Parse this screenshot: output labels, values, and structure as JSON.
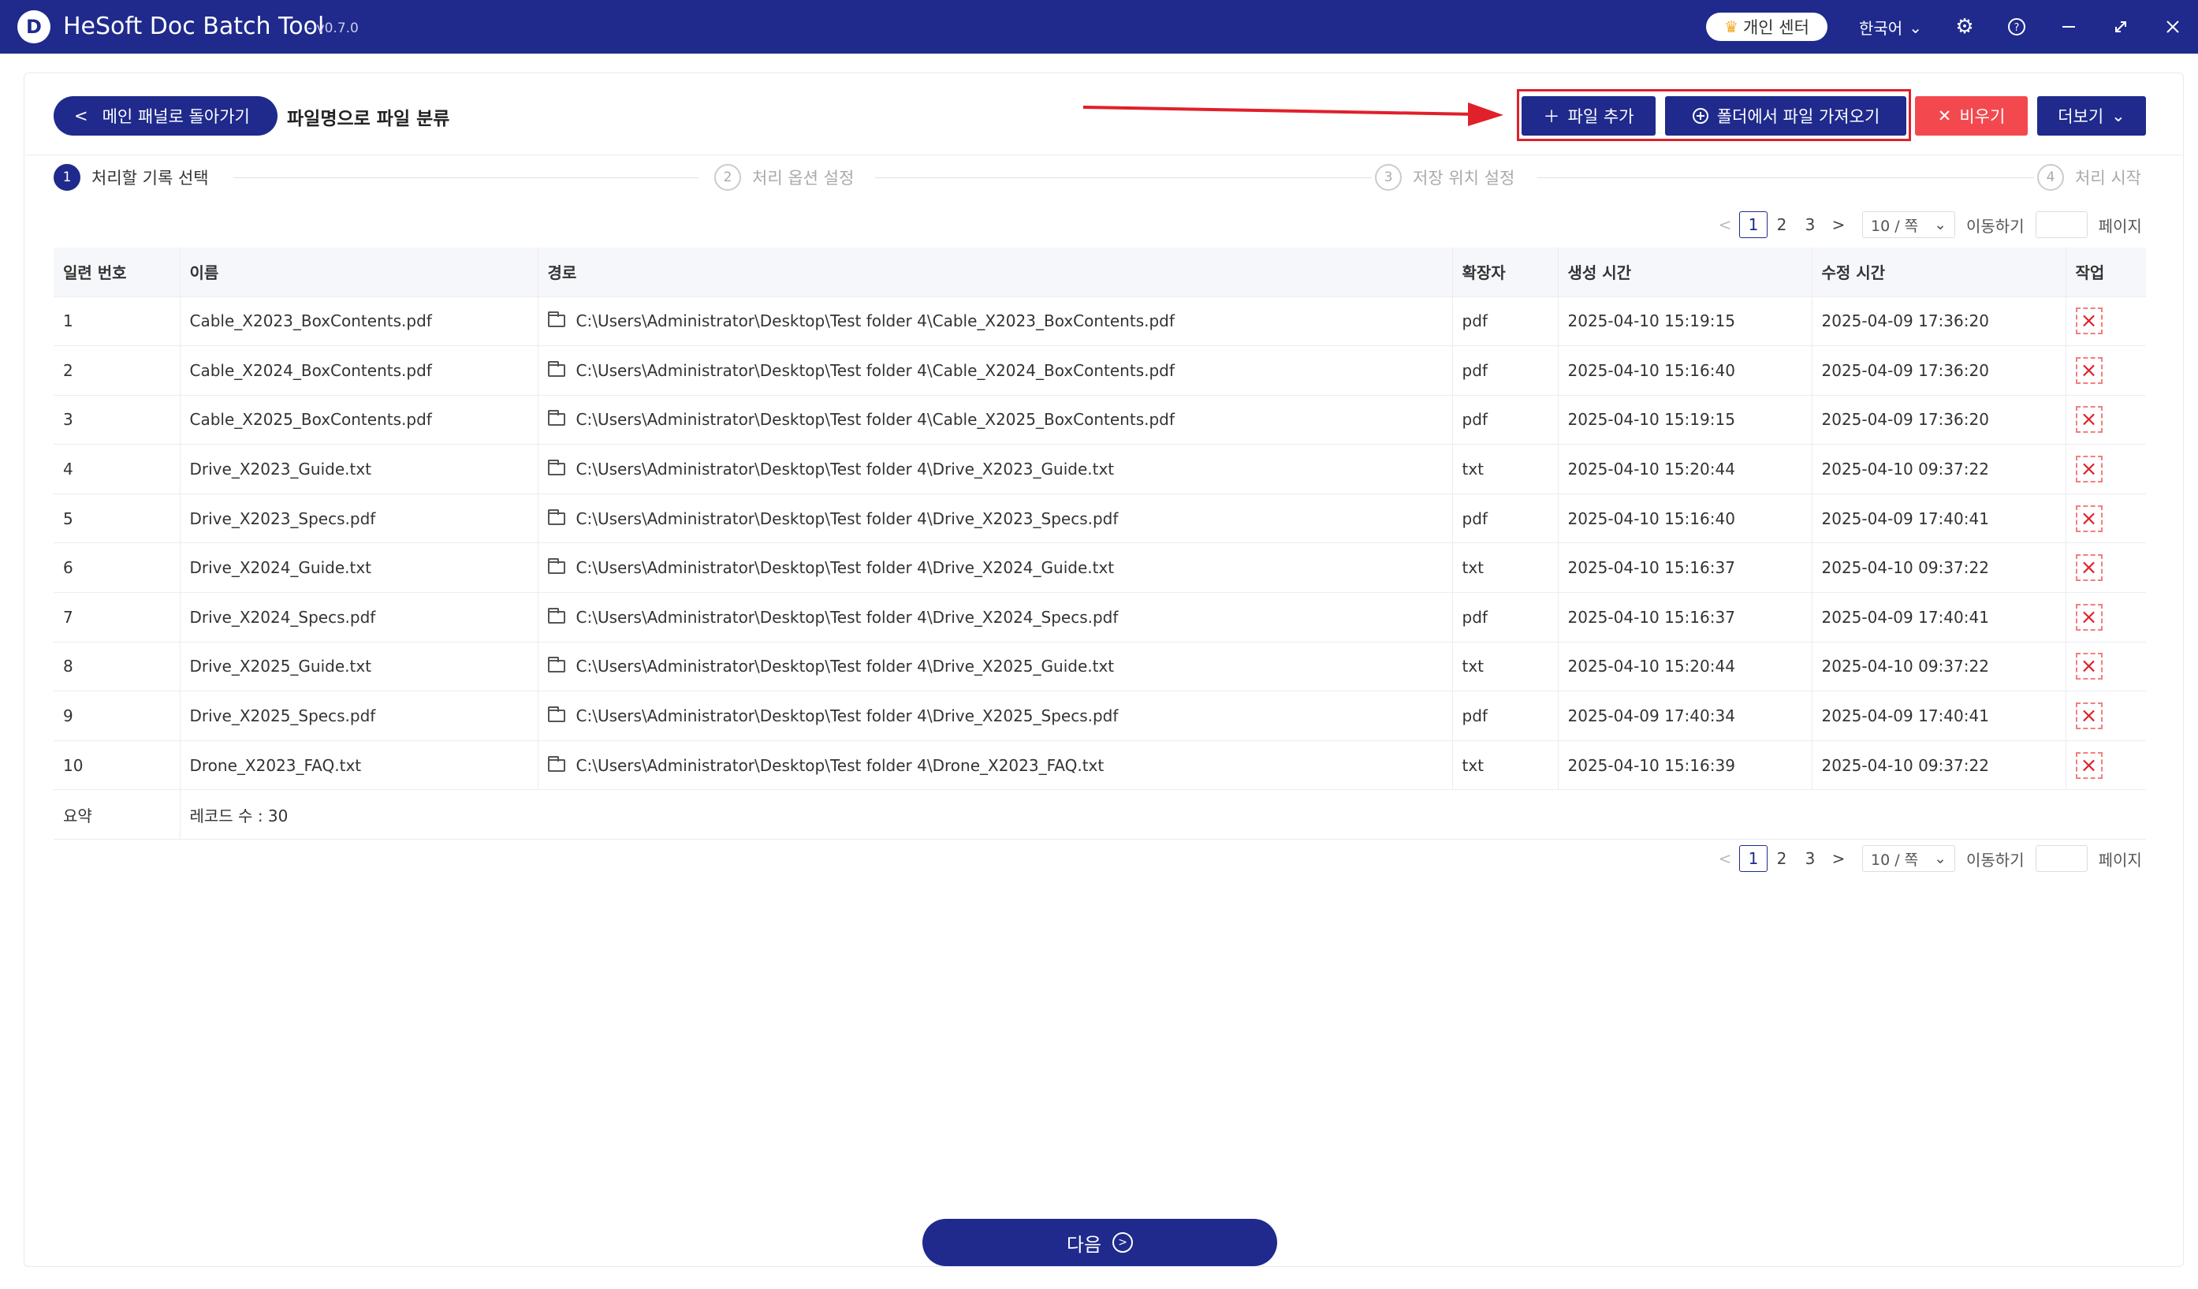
{
  "app": {
    "logo_letter": "D",
    "title": "HeSoft Doc Batch Tool",
    "version": "- v0.7.0",
    "vip_label": "개인 센터",
    "language": "한국어"
  },
  "header": {
    "back_label": "메인 패널로 돌아가기",
    "page_title": "파일명으로 파일 분류",
    "add_file_label": "파일 추가",
    "import_folder_label": "폴더에서 파일 가져오기",
    "clear_label": "비우기",
    "more_label": "더보기"
  },
  "steps": [
    {
      "num": "1",
      "label": "처리할 기록 선택"
    },
    {
      "num": "2",
      "label": "처리 옵션 설정"
    },
    {
      "num": "3",
      "label": "저장 위치 설정"
    },
    {
      "num": "4",
      "label": "처리 시작"
    }
  ],
  "pagination": {
    "pages": [
      "1",
      "2",
      "3"
    ],
    "current": "1",
    "page_size": "10 / 쪽",
    "goto_label": "이동하기",
    "page_label": "페이지"
  },
  "table": {
    "columns": [
      "일련 번호",
      "이름",
      "경로",
      "확장자",
      "생성 시간",
      "수정 시간",
      "작업"
    ],
    "rows": [
      {
        "no": "1",
        "name": "Cable_X2023_BoxContents.pdf",
        "path": "C:\\Users\\Administrator\\Desktop\\Test folder 4\\Cable_X2023_BoxContents.pdf",
        "ext": "pdf",
        "created": "2025-04-10 15:19:15",
        "modified": "2025-04-09 17:36:20"
      },
      {
        "no": "2",
        "name": "Cable_X2024_BoxContents.pdf",
        "path": "C:\\Users\\Administrator\\Desktop\\Test folder 4\\Cable_X2024_BoxContents.pdf",
        "ext": "pdf",
        "created": "2025-04-10 15:16:40",
        "modified": "2025-04-09 17:36:20"
      },
      {
        "no": "3",
        "name": "Cable_X2025_BoxContents.pdf",
        "path": "C:\\Users\\Administrator\\Desktop\\Test folder 4\\Cable_X2025_BoxContents.pdf",
        "ext": "pdf",
        "created": "2025-04-10 15:19:15",
        "modified": "2025-04-09 17:36:20"
      },
      {
        "no": "4",
        "name": "Drive_X2023_Guide.txt",
        "path": "C:\\Users\\Administrator\\Desktop\\Test folder 4\\Drive_X2023_Guide.txt",
        "ext": "txt",
        "created": "2025-04-10 15:20:44",
        "modified": "2025-04-10 09:37:22"
      },
      {
        "no": "5",
        "name": "Drive_X2023_Specs.pdf",
        "path": "C:\\Users\\Administrator\\Desktop\\Test folder 4\\Drive_X2023_Specs.pdf",
        "ext": "pdf",
        "created": "2025-04-10 15:16:40",
        "modified": "2025-04-09 17:40:41"
      },
      {
        "no": "6",
        "name": "Drive_X2024_Guide.txt",
        "path": "C:\\Users\\Administrator\\Desktop\\Test folder 4\\Drive_X2024_Guide.txt",
        "ext": "txt",
        "created": "2025-04-10 15:16:37",
        "modified": "2025-04-10 09:37:22"
      },
      {
        "no": "7",
        "name": "Drive_X2024_Specs.pdf",
        "path": "C:\\Users\\Administrator\\Desktop\\Test folder 4\\Drive_X2024_Specs.pdf",
        "ext": "pdf",
        "created": "2025-04-10 15:16:37",
        "modified": "2025-04-09 17:40:41"
      },
      {
        "no": "8",
        "name": "Drive_X2025_Guide.txt",
        "path": "C:\\Users\\Administrator\\Desktop\\Test folder 4\\Drive_X2025_Guide.txt",
        "ext": "txt",
        "created": "2025-04-10 15:20:44",
        "modified": "2025-04-10 09:37:22"
      },
      {
        "no": "9",
        "name": "Drive_X2025_Specs.pdf",
        "path": "C:\\Users\\Administrator\\Desktop\\Test folder 4\\Drive_X2025_Specs.pdf",
        "ext": "pdf",
        "created": "2025-04-09 17:40:34",
        "modified": "2025-04-09 17:40:41"
      },
      {
        "no": "10",
        "name": "Drone_X2023_FAQ.txt",
        "path": "C:\\Users\\Administrator\\Desktop\\Test folder 4\\Drone_X2023_FAQ.txt",
        "ext": "txt",
        "created": "2025-04-10 15:16:39",
        "modified": "2025-04-10 09:37:22"
      }
    ],
    "summary_label": "요약",
    "summary_value": "레코드 수 : 30"
  },
  "footer": {
    "next_label": "다음"
  },
  "colors": {
    "primary": "#1f2a8c",
    "danger": "#f3494e",
    "highlight": "#e0202a"
  }
}
